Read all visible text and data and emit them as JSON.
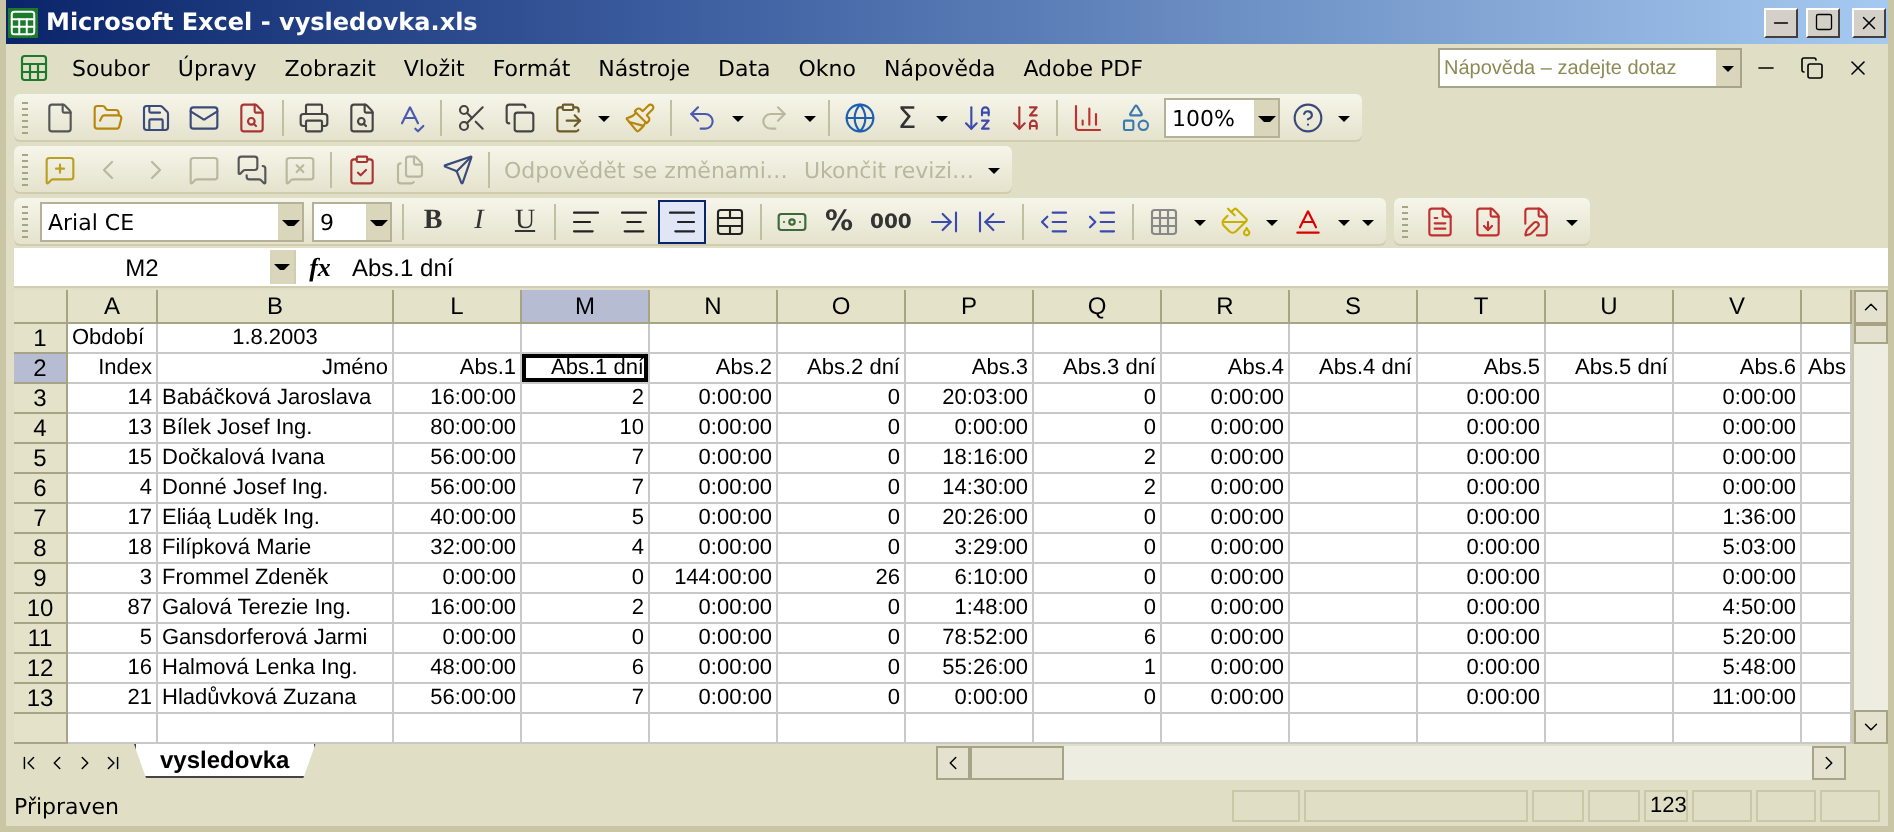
{
  "window": {
    "title": "Microsoft Excel - vysledovka.xls"
  },
  "menu": [
    "Soubor",
    "Úpravy",
    "Zobrazit",
    "Vložit",
    "Formát",
    "Nástroje",
    "Data",
    "Okno",
    "Nápověda",
    "Adobe PDF"
  ],
  "help_box": {
    "placeholder": "Nápověda – zadejte dotaz"
  },
  "standard_toolbar": {
    "autosum_label": "Σ",
    "zoom": "100%"
  },
  "reviewing_toolbar": {
    "actions": [
      {
        "label": "Odpovědět se změnami…",
        "disabled": true
      },
      {
        "label": "Ukončit revizi…",
        "disabled": true
      }
    ]
  },
  "formatting_toolbar": {
    "font": "Arial CE",
    "size": "9",
    "styles": [
      {
        "label": "B"
      },
      {
        "label": "I"
      },
      {
        "label": "U"
      }
    ],
    "alignments": [
      {
        "selected": false
      },
      {
        "selected": false
      },
      {
        "selected": true
      }
    ],
    "number_formats": [
      "%",
      "000"
    ]
  },
  "formula_bar": {
    "name_box": "M2",
    "fx_label": "fx",
    "value": "Abs.1 dní"
  },
  "sheet": {
    "columns": [
      {
        "letter": "A",
        "selected": false
      },
      {
        "letter": "B",
        "selected": false
      },
      {
        "letter": "L",
        "selected": false
      },
      {
        "letter": "M",
        "selected": true
      },
      {
        "letter": "N",
        "selected": false
      },
      {
        "letter": "O",
        "selected": false
      },
      {
        "letter": "P",
        "selected": false
      },
      {
        "letter": "Q",
        "selected": false
      },
      {
        "letter": "R",
        "selected": false
      },
      {
        "letter": "S",
        "selected": false
      },
      {
        "letter": "T",
        "selected": false
      },
      {
        "letter": "U",
        "selected": false
      },
      {
        "letter": "V",
        "selected": false
      },
      {
        "selected": false
      }
    ],
    "rows": [
      {
        "number": "1",
        "selected": false,
        "cells": [
          "Období",
          "1.8.2003",
          null,
          null,
          null,
          null,
          null,
          null,
          null,
          null,
          null,
          null,
          null,
          null
        ]
      },
      {
        "number": "2",
        "selected": true,
        "cells": [
          "Index",
          "Jméno",
          "Abs.1",
          "Abs.1 dní",
          "Abs.2",
          "Abs.2 dní",
          "Abs.3",
          "Abs.3 dní",
          "Abs.4",
          "Abs.4 dní",
          "Abs.5",
          "Abs.5 dní",
          "Abs.6",
          "Abs"
        ]
      },
      {
        "number": "3",
        "selected": false,
        "cells": [
          "14",
          "Babáčková Jaroslava",
          "16:00:00",
          "2",
          "0:00:00",
          "0",
          "20:03:00",
          "0",
          "0:00:00",
          null,
          "0:00:00",
          null,
          "0:00:00",
          null
        ]
      },
      {
        "number": "4",
        "selected": false,
        "cells": [
          "13",
          "Bílek Josef Ing.",
          "80:00:00",
          "10",
          "0:00:00",
          "0",
          "0:00:00",
          "0",
          "0:00:00",
          null,
          "0:00:00",
          null,
          "0:00:00",
          null
        ]
      },
      {
        "number": "5",
        "selected": false,
        "cells": [
          "15",
          "Dočkalová Ivana",
          "56:00:00",
          "7",
          "0:00:00",
          "0",
          "18:16:00",
          "2",
          "0:00:00",
          null,
          "0:00:00",
          null,
          "0:00:00",
          null
        ]
      },
      {
        "number": "6",
        "selected": false,
        "cells": [
          "4",
          "Donné Josef Ing.",
          "56:00:00",
          "7",
          "0:00:00",
          "0",
          "14:30:00",
          "2",
          "0:00:00",
          null,
          "0:00:00",
          null,
          "0:00:00",
          null
        ]
      },
      {
        "number": "7",
        "selected": false,
        "cells": [
          "17",
          "Eliáą Luděk Ing.",
          "40:00:00",
          "5",
          "0:00:00",
          "0",
          "20:26:00",
          "0",
          "0:00:00",
          null,
          "0:00:00",
          null,
          "1:36:00",
          null
        ]
      },
      {
        "number": "8",
        "selected": false,
        "cells": [
          "18",
          "Filípková Marie",
          "32:00:00",
          "4",
          "0:00:00",
          "0",
          "3:29:00",
          "0",
          "0:00:00",
          null,
          "0:00:00",
          null,
          "5:03:00",
          null
        ]
      },
      {
        "number": "9",
        "selected": false,
        "cells": [
          "3",
          "Frommel Zdeněk",
          "0:00:00",
          "0",
          "144:00:00",
          "26",
          "6:10:00",
          "0",
          "0:00:00",
          null,
          "0:00:00",
          null,
          "0:00:00",
          null
        ]
      },
      {
        "number": "10",
        "selected": false,
        "cells": [
          "87",
          "Galová Terezie Ing.",
          "16:00:00",
          "2",
          "0:00:00",
          "0",
          "1:48:00",
          "0",
          "0:00:00",
          null,
          "0:00:00",
          null,
          "4:50:00",
          null
        ]
      },
      {
        "number": "11",
        "selected": false,
        "cells": [
          "5",
          "Gansdorferová Jarmi",
          "0:00:00",
          "0",
          "0:00:00",
          "0",
          "78:52:00",
          "6",
          "0:00:00",
          null,
          "0:00:00",
          null,
          "5:20:00",
          null
        ]
      },
      {
        "number": "12",
        "selected": false,
        "cells": [
          "16",
          "Halmová Lenka Ing.",
          "48:00:00",
          "6",
          "0:00:00",
          "0",
          "55:26:00",
          "1",
          "0:00:00",
          null,
          "0:00:00",
          null,
          "5:48:00",
          null
        ]
      },
      {
        "number": "13",
        "selected": false,
        "cells": [
          "21",
          "Hladůvková Zuzana",
          "56:00:00",
          "7",
          "0:00:00",
          "0",
          "0:00:00",
          "0",
          "0:00:00",
          null,
          "0:00:00",
          null,
          "11:00:00",
          null
        ]
      }
    ]
  },
  "sheet_tabs": [
    {
      "label": "vysledovka",
      "selected": true
    }
  ],
  "status_bar": {
    "text": "Připraven",
    "indicator": "123"
  }
}
